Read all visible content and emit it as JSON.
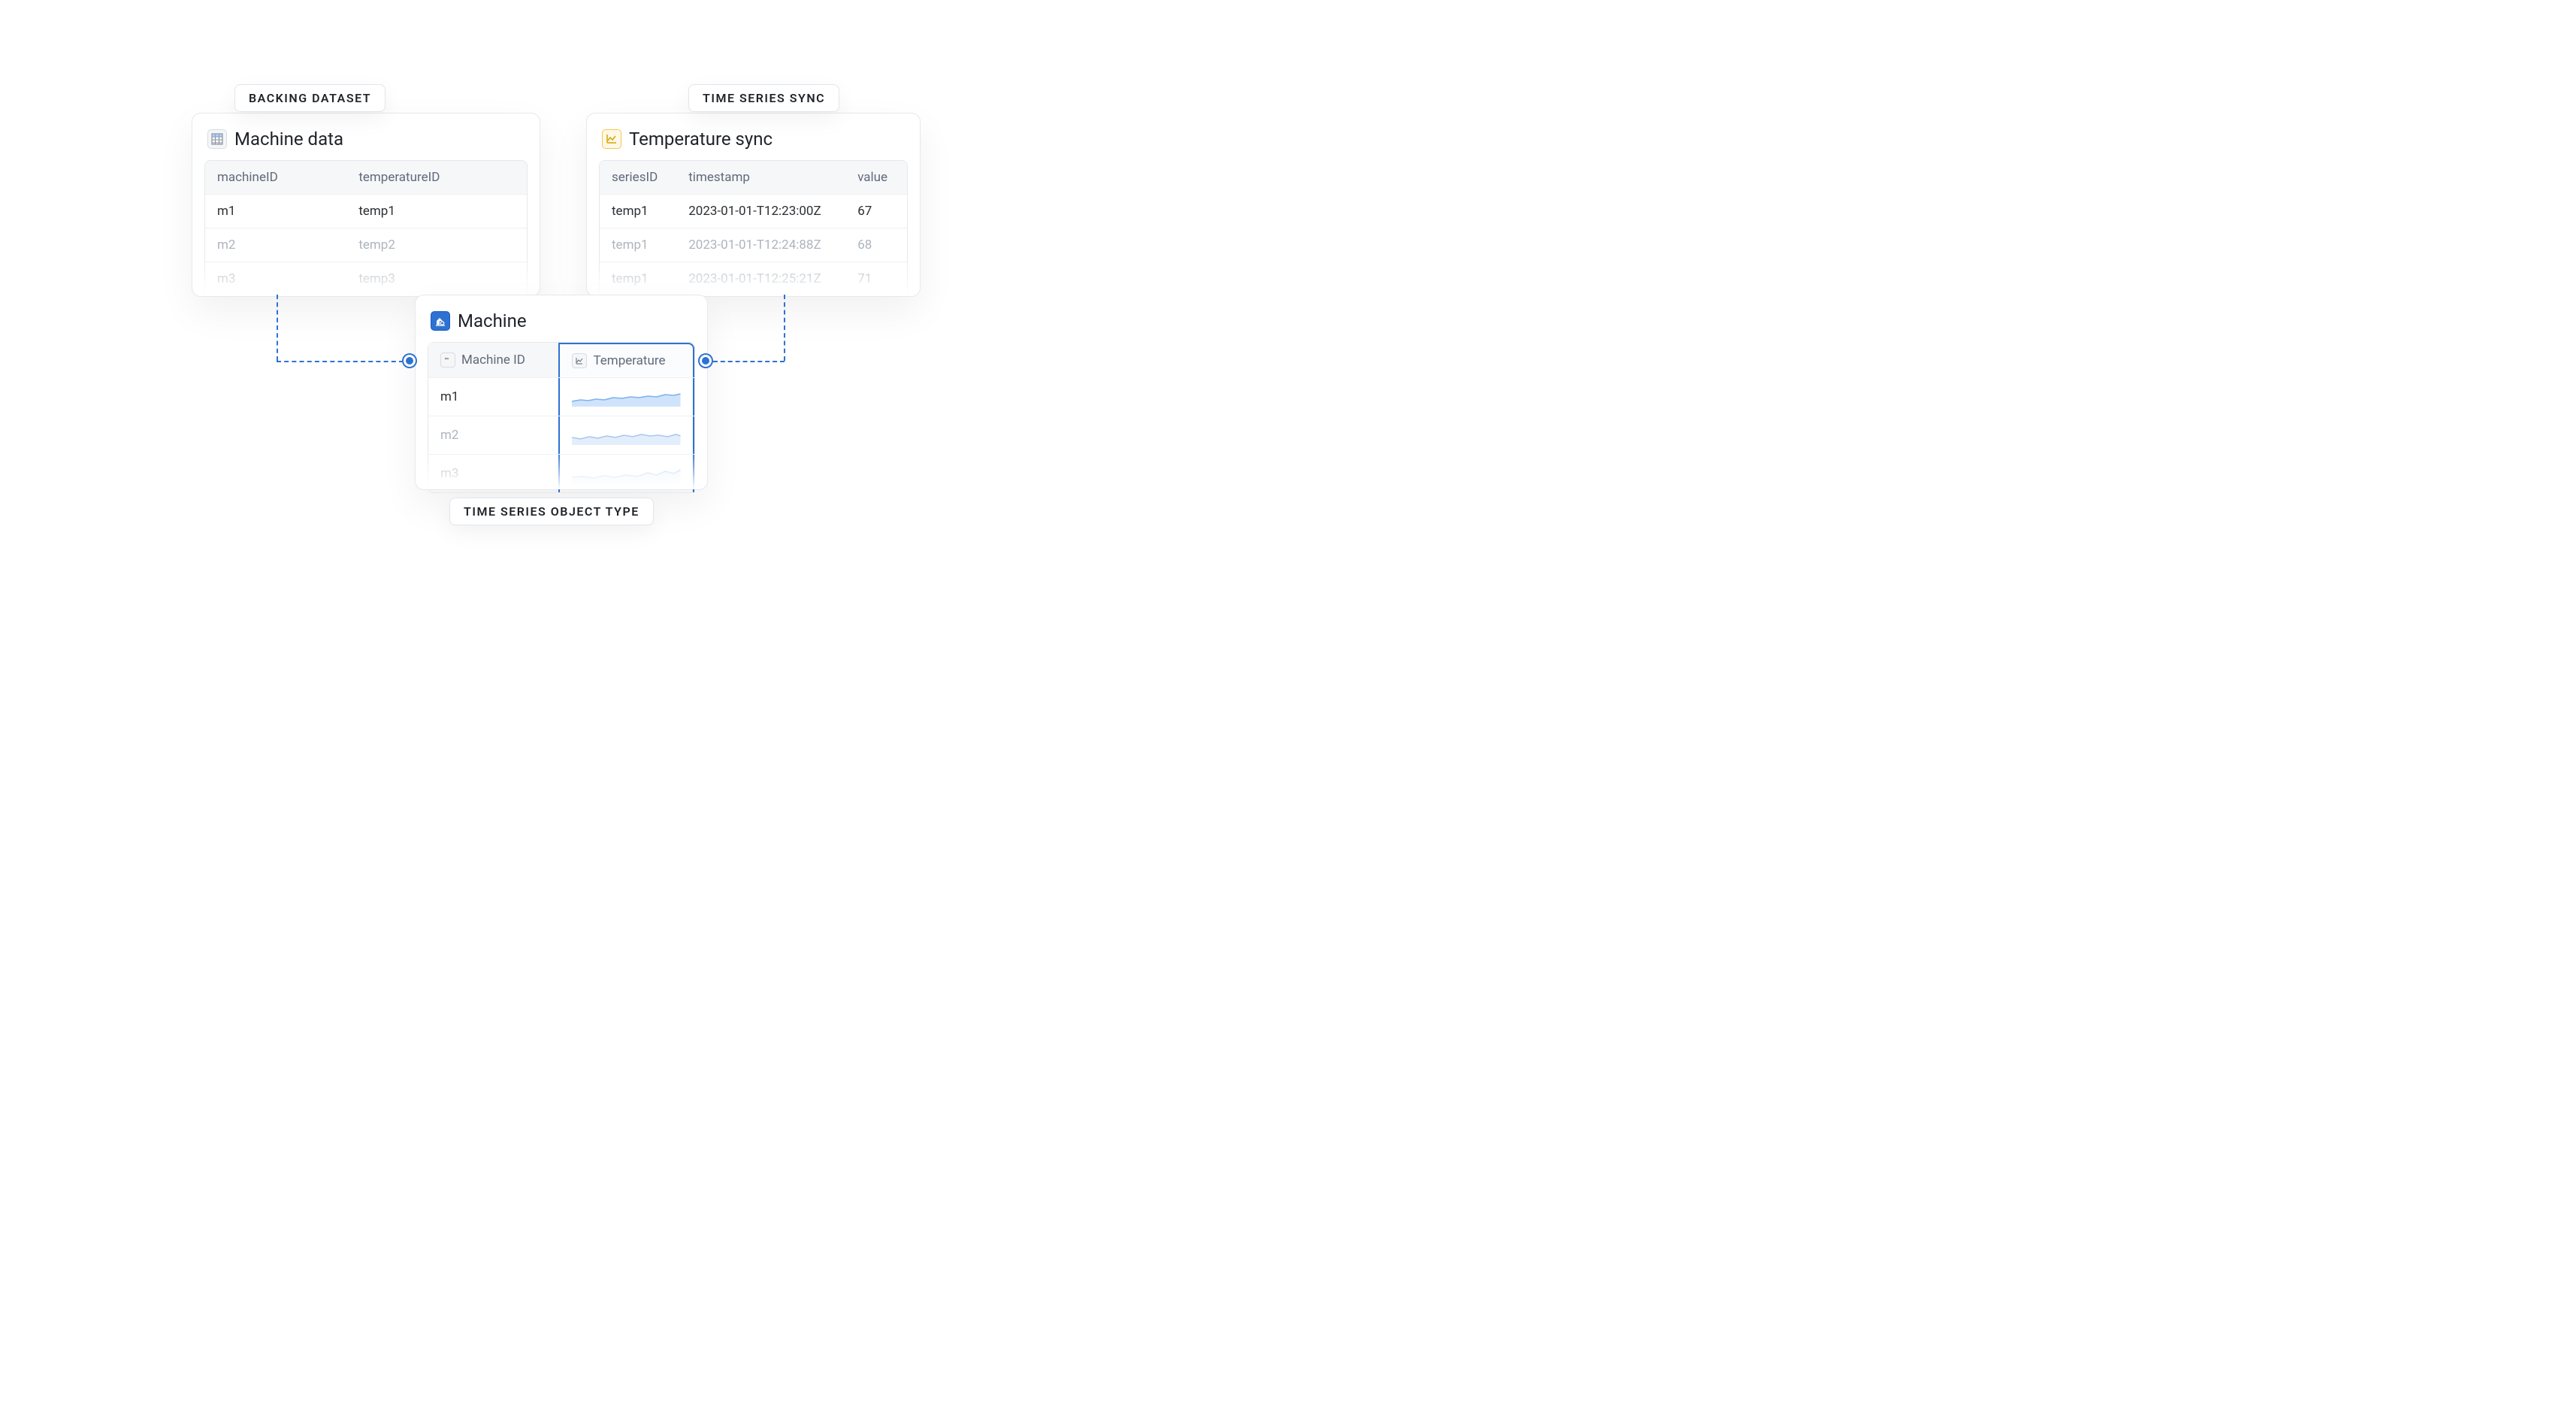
{
  "labels": {
    "backing_dataset": "BACKING DATASET",
    "time_series_sync": "TIME SERIES SYNC",
    "time_series_object_type": "TIME SERIES OBJECT TYPE"
  },
  "dataset": {
    "title": "Machine data",
    "columns": {
      "c1": "machineID",
      "c2": "temperatureID"
    },
    "rows": [
      {
        "c1": "m1",
        "c2": "temp1",
        "muted": false
      },
      {
        "c1": "m2",
        "c2": "temp2",
        "muted": true
      },
      {
        "c1": "m3",
        "c2": "temp3",
        "muted": true
      }
    ]
  },
  "sync": {
    "title": "Temperature sync",
    "columns": {
      "c1": "seriesID",
      "c2": "timestamp",
      "c3": "value"
    },
    "rows": [
      {
        "c1": "temp1",
        "c2": "2023-01-01-T12:23:00Z",
        "c3": "67",
        "muted": false
      },
      {
        "c1": "temp1",
        "c2": "2023-01-01-T12:24:88Z",
        "c3": "68",
        "muted": true
      },
      {
        "c1": "temp1",
        "c2": "2023-01-01-T12:25:21Z",
        "c3": "71",
        "muted": true
      }
    ]
  },
  "object": {
    "title": "Machine",
    "columns": {
      "c1": "Machine ID",
      "c2": "Temperature"
    },
    "rows": [
      {
        "c1": "m1",
        "muted": false
      },
      {
        "c1": "m2",
        "muted": true
      },
      {
        "c1": "m3",
        "muted": true
      }
    ]
  }
}
